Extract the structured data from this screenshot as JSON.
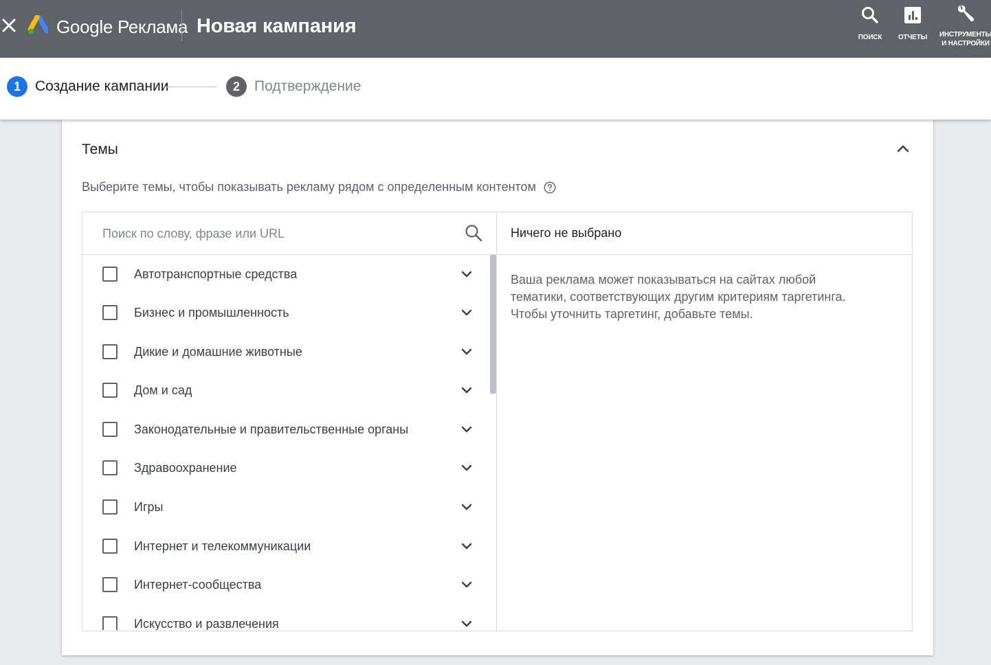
{
  "header": {
    "product_name": "Google Реклама",
    "page_title": "Новая кампания",
    "actions": [
      {
        "label": "ПОИСК",
        "icon": "search-icon"
      },
      {
        "label": "ОТЧЕТЫ",
        "icon": "reports-icon"
      },
      {
        "label": "ИНСТРУМЕНТЫ И НАСТРОЙКИ",
        "label_line1": "ИНСТРУМЕНТЫ",
        "label_line2": "И НАСТРОЙКИ",
        "icon": "wrench-icon"
      }
    ]
  },
  "stepper": {
    "steps": [
      {
        "number": "1",
        "label": "Создание кампании",
        "state": "active"
      },
      {
        "number": "2",
        "label": "Подтверждение",
        "state": "pending"
      }
    ]
  },
  "topics": {
    "title": "Темы",
    "description": "Выберите темы, чтобы показывать рекламу рядом с определенным контентом",
    "search_placeholder": "Поиск по слову, фразе или URL",
    "items": [
      {
        "label": "Автотранспортные средства",
        "checked": false
      },
      {
        "label": "Бизнес и промышленность",
        "checked": false
      },
      {
        "label": "Дикие и домашние животные",
        "checked": false
      },
      {
        "label": "Дом и сад",
        "checked": false
      },
      {
        "label": "Законодательные и правительственные органы",
        "checked": false
      },
      {
        "label": "Здравоохранение",
        "checked": false
      },
      {
        "label": "Игры",
        "checked": false
      },
      {
        "label": "Интернет и телекоммуникации",
        "checked": false
      },
      {
        "label": "Интернет-сообщества",
        "checked": false
      },
      {
        "label": "Искусство и развлечения",
        "checked": false
      }
    ],
    "selected_title": "Ничего не выбрано",
    "selected_info": "Ваша реклама может показываться на сайтах любой тематики, соответствующих другим критериям таргетинга. Чтобы уточнить таргетинг, добавьте темы."
  },
  "colors": {
    "topbar": "#5f6368",
    "accent": "#1a73e8",
    "pending_step": "#5f6368"
  }
}
